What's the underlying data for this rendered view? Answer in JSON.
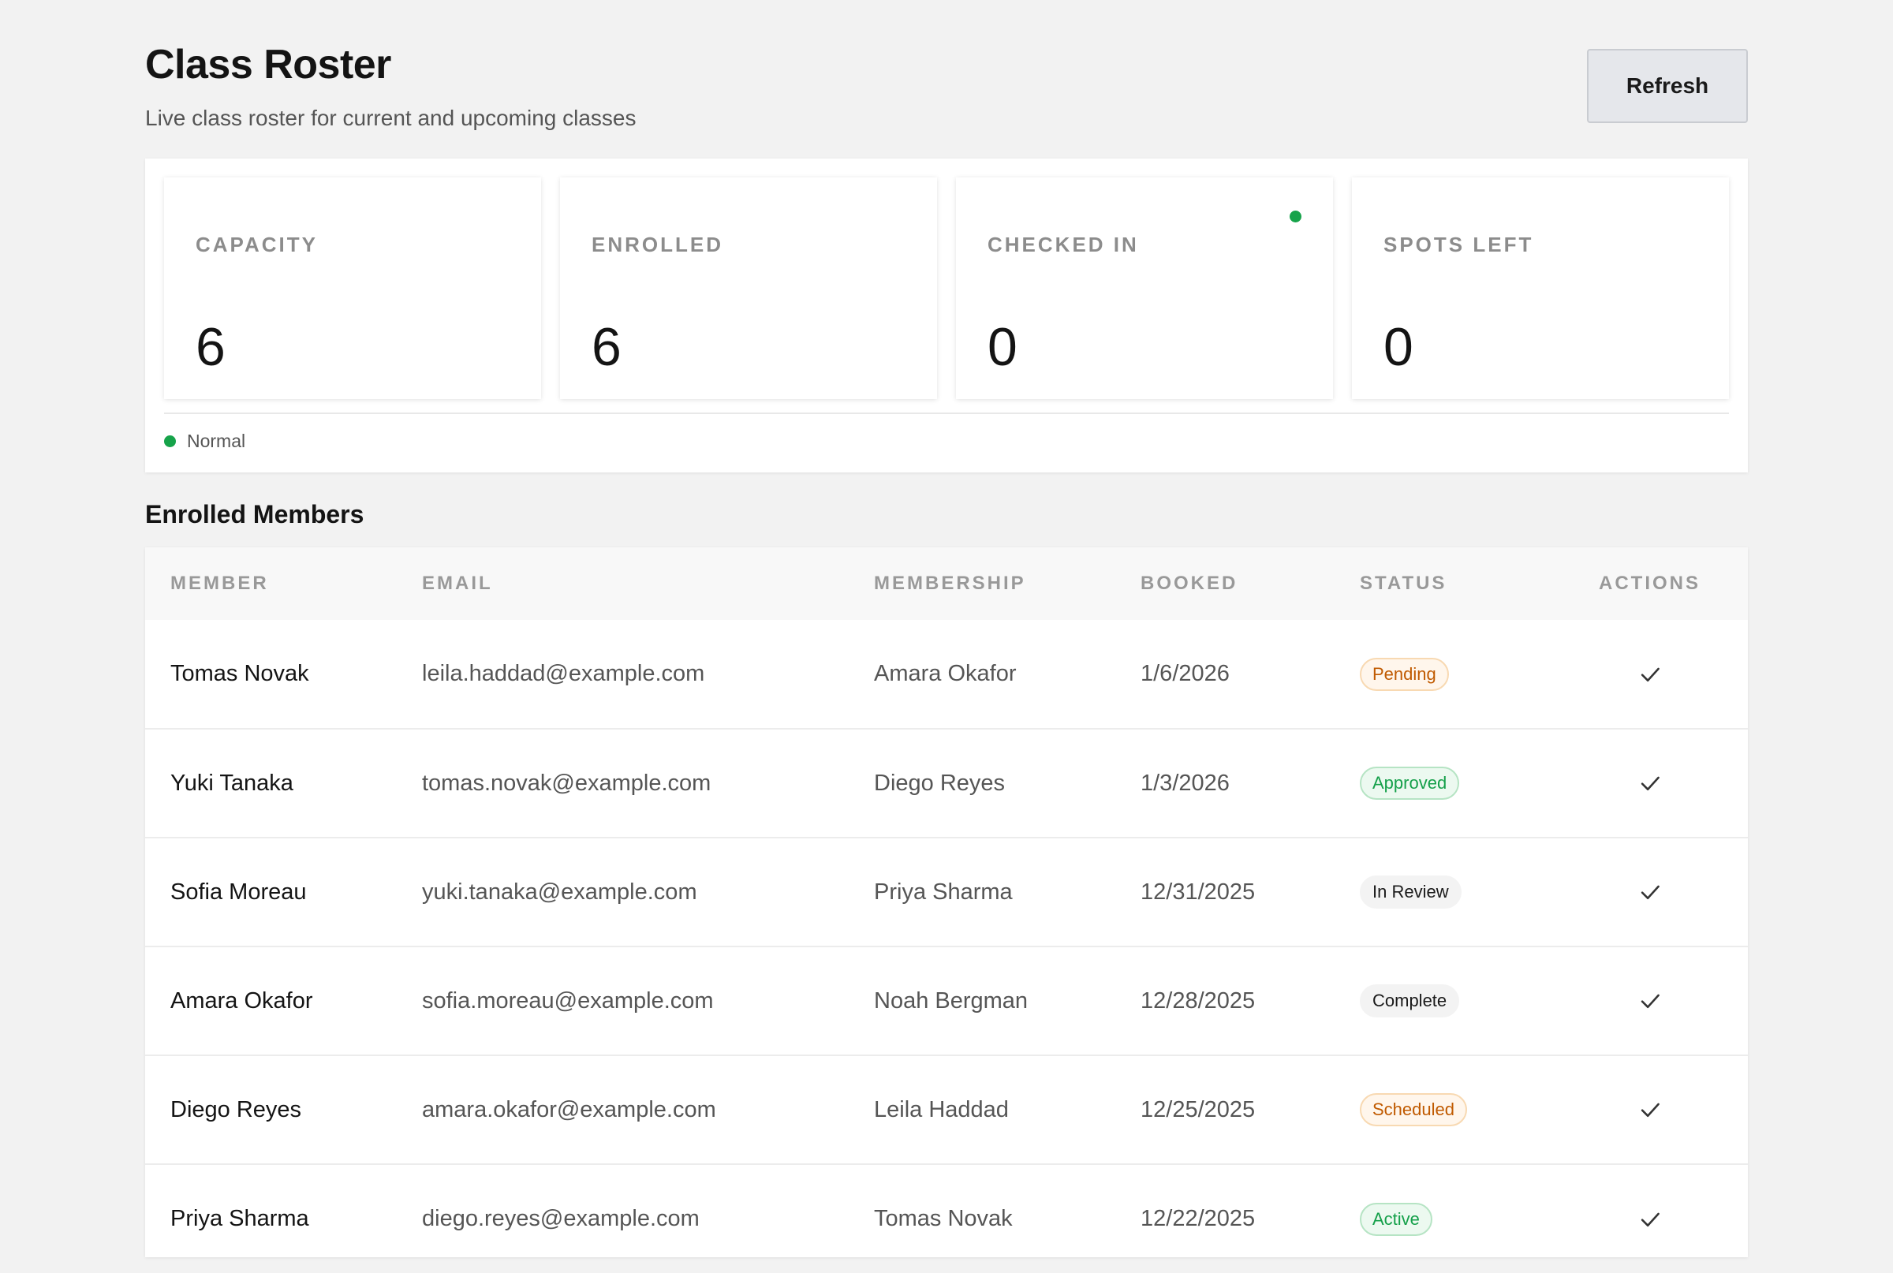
{
  "header": {
    "title": "Class Roster",
    "subtitle": "Live class roster for current and upcoming classes",
    "refresh_label": "Refresh"
  },
  "colors": {
    "status_green": "#16a34a",
    "badge_orange": "#c05a00",
    "badge_green": "#15a04a",
    "button_bg": "#e5e7eb"
  },
  "stats": {
    "capacity": {
      "label": "CAPACITY",
      "value": "6"
    },
    "enrolled": {
      "label": "ENROLLED",
      "value": "6"
    },
    "checked_in": {
      "label": "CHECKED IN",
      "value": "0",
      "indicator_icon": "status-dot-icon"
    },
    "spots_left": {
      "label": "SPOTS LEFT",
      "value": "0"
    },
    "status_text": "Normal"
  },
  "members_section": {
    "title": "Enrolled Members",
    "columns": {
      "member": "MEMBER",
      "email": "EMAIL",
      "membership": "MEMBERSHIP",
      "booked": "BOOKED",
      "status": "STATUS",
      "actions": "ACTIONS"
    },
    "action_icon": "check-icon",
    "rows": [
      {
        "member": "Tomas Novak",
        "email": "leila.haddad@example.com",
        "membership": "Amara Okafor",
        "booked": "1/6/2026",
        "status": "Pending",
        "tone": "orange"
      },
      {
        "member": "Yuki Tanaka",
        "email": "tomas.novak@example.com",
        "membership": "Diego Reyes",
        "booked": "1/3/2026",
        "status": "Approved",
        "tone": "green"
      },
      {
        "member": "Sofia Moreau",
        "email": "yuki.tanaka@example.com",
        "membership": "Priya Sharma",
        "booked": "12/31/2025",
        "status": "In Review",
        "tone": "gray"
      },
      {
        "member": "Amara Okafor",
        "email": "sofia.moreau@example.com",
        "membership": "Noah Bergman",
        "booked": "12/28/2025",
        "status": "Complete",
        "tone": "gray"
      },
      {
        "member": "Diego Reyes",
        "email": "amara.okafor@example.com",
        "membership": "Leila Haddad",
        "booked": "12/25/2025",
        "status": "Scheduled",
        "tone": "orange"
      },
      {
        "member": "Priya Sharma",
        "email": "diego.reyes@example.com",
        "membership": "Tomas Novak",
        "booked": "12/22/2025",
        "status": "Active",
        "tone": "green"
      }
    ]
  }
}
